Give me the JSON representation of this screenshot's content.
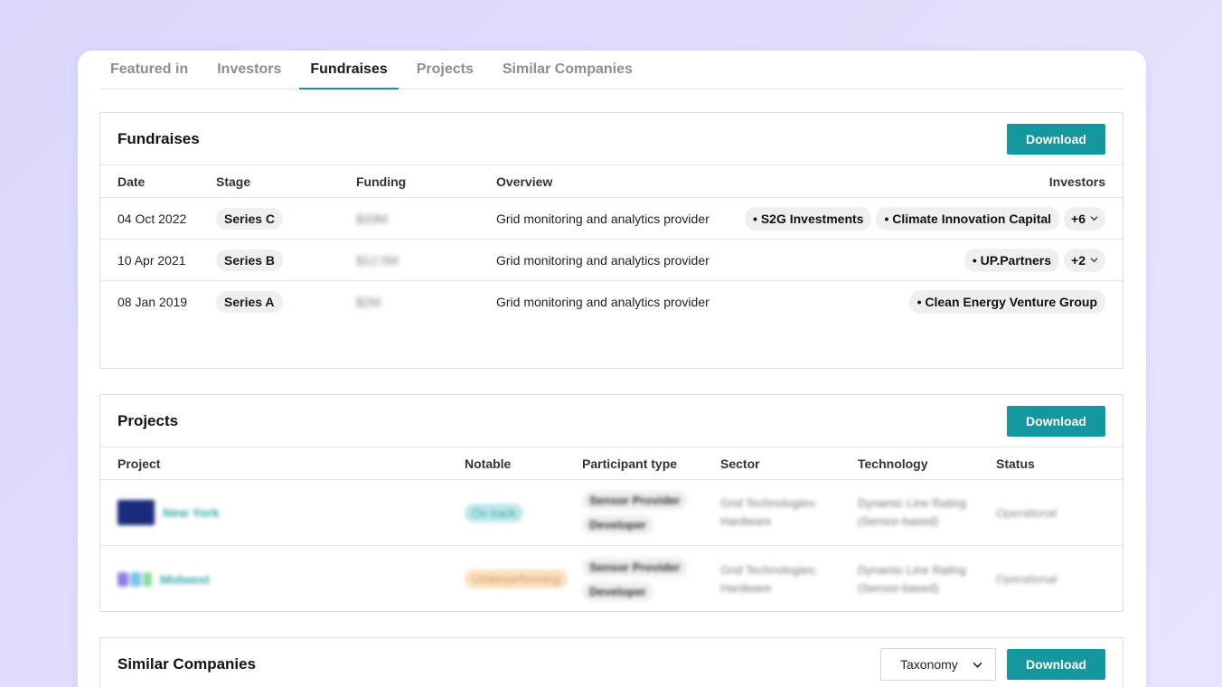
{
  "tabs": [
    {
      "label": "Featured in"
    },
    {
      "label": "Investors"
    },
    {
      "label": "Fundraises",
      "active": true
    },
    {
      "label": "Projects"
    },
    {
      "label": "Similar Companies"
    }
  ],
  "fundraises": {
    "title": "Fundraises",
    "download_label": "Download",
    "columns": {
      "date": "Date",
      "stage": "Stage",
      "funding": "Funding",
      "overview": "Overview",
      "investors": "Investors"
    },
    "rows": [
      {
        "date": "04 Oct 2022",
        "stage": "Series C",
        "funding": "$33M",
        "overview": "Grid monitoring and analytics provider",
        "investors": [
          "• S2G Investments",
          "• Climate Innovation Capital"
        ],
        "more": "+6"
      },
      {
        "date": "10 Apr 2021",
        "stage": "Series B",
        "funding": "$12.5M",
        "overview": "Grid monitoring and analytics provider",
        "investors": [
          "• UP.Partners"
        ],
        "more": "+2"
      },
      {
        "date": "08 Jan 2019",
        "stage": "Series A",
        "funding": "$2M",
        "overview": "Grid monitoring and analytics provider",
        "investors": [
          "• Clean Energy Venture Group"
        ],
        "more": ""
      }
    ]
  },
  "projects": {
    "title": "Projects",
    "download_label": "Download",
    "columns": {
      "project": "Project",
      "notable": "Notable",
      "participant_type": "Participant type",
      "sector": "Sector",
      "technology": "Technology",
      "status": "Status"
    },
    "rows": [
      {
        "name": "New York",
        "notable": "On track",
        "ptypes": [
          "Sensor Provider",
          "Developer"
        ],
        "sector_1": "Grid Technologies:",
        "sector_2": "Hardware",
        "tech_1": "Dynamic Line Rating",
        "tech_2": "(Sensor-based)",
        "status": "Operational"
      },
      {
        "name": "Midwest",
        "notable": "Underperforming",
        "ptypes": [
          "Sensor Provider",
          "Developer"
        ],
        "sector_1": "Grid Technologies:",
        "sector_2": "Hardware",
        "tech_1": "Dynamic Line Rating",
        "tech_2": "(Sensor-based)",
        "status": "Operational"
      }
    ]
  },
  "similar": {
    "title": "Similar Companies",
    "taxonomy_label": "Taxonomy",
    "download_label": "Download"
  },
  "colors": {
    "accent": "#14979e",
    "background": "#dcd9fc"
  }
}
